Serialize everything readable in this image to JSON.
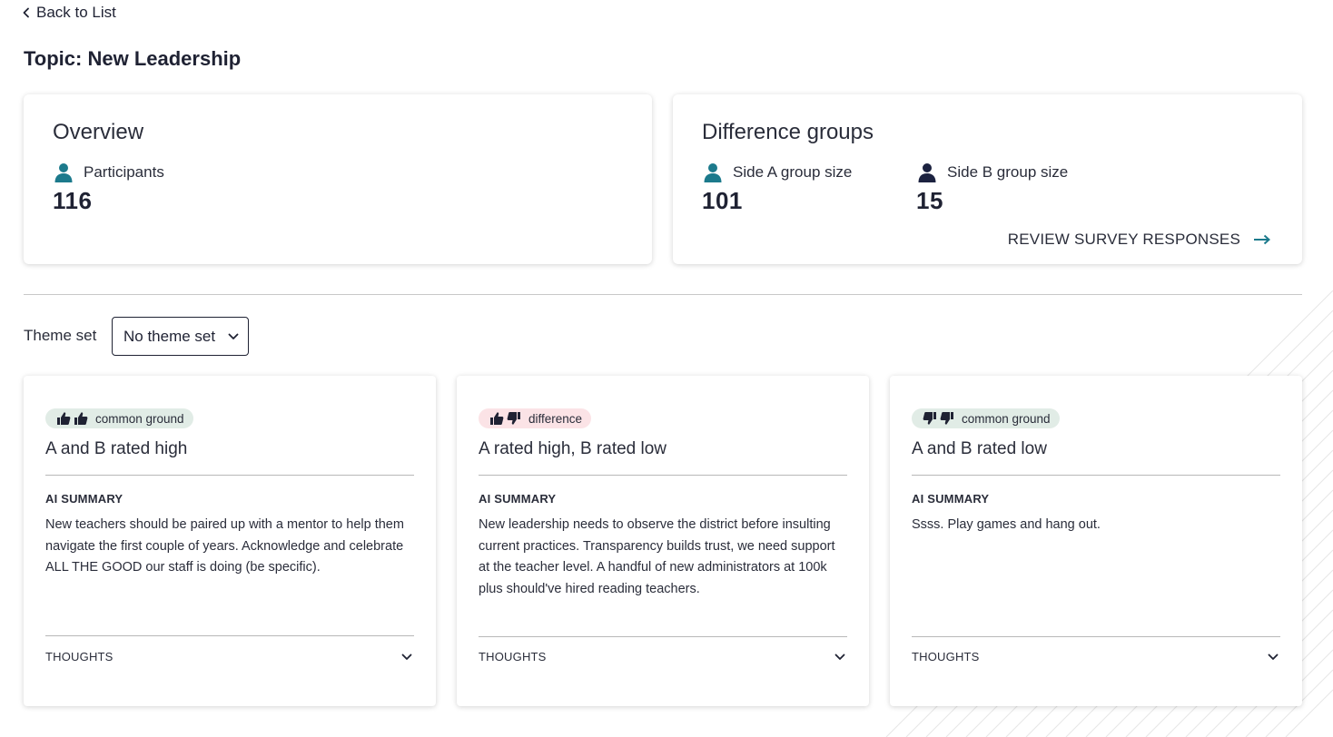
{
  "nav": {
    "back_label": "Back to List"
  },
  "page": {
    "title": "Topic: New Leadership"
  },
  "overview": {
    "heading": "Overview",
    "participants_label": "Participants",
    "participants_value": "116"
  },
  "difference_groups": {
    "heading": "Difference groups",
    "side_a_label": "Side A group size",
    "side_a_value": "101",
    "side_b_label": "Side B group size",
    "side_b_value": "15",
    "review_label": "REVIEW SURVEY RESPONSES"
  },
  "theme_set": {
    "label": "Theme set",
    "selected": "No theme set"
  },
  "theme_cards": [
    {
      "badge": "common ground",
      "badge_icons": [
        "thumbs-up-icon",
        "thumbs-up-icon"
      ],
      "title": "A and B rated high",
      "ai_label": "AI SUMMARY",
      "ai_text": "New teachers should be paired up with a mentor to help them navigate the first couple of years. Acknowledge and celebrate ALL THE GOOD our staff is doing (be specific).",
      "thoughts_label": "THOUGHTS"
    },
    {
      "badge": "difference",
      "badge_icons": [
        "thumbs-up-icon",
        "thumbs-down-icon"
      ],
      "title": "A rated high, B rated low",
      "ai_label": "AI SUMMARY",
      "ai_text": "New leadership needs to observe the district before insulting current practices. Transparency builds trust, we need support at the teacher level. A handful of new administrators at 100k plus should've hired reading teachers.",
      "thoughts_label": "THOUGHTS"
    },
    {
      "badge": "common ground",
      "badge_icons": [
        "thumbs-down-icon",
        "thumbs-down-icon"
      ],
      "title": "A and B rated low",
      "ai_label": "AI SUMMARY",
      "ai_text": "Ssss. Play games and hang out.",
      "thoughts_label": "THOUGHTS"
    }
  ],
  "colors": {
    "side_a": "#1c7a8c",
    "side_b": "#1c2240",
    "accent": "#1c7a8c",
    "common_badge_bg": "#e1ece6",
    "difference_badge_bg": "#fbe3e6"
  }
}
